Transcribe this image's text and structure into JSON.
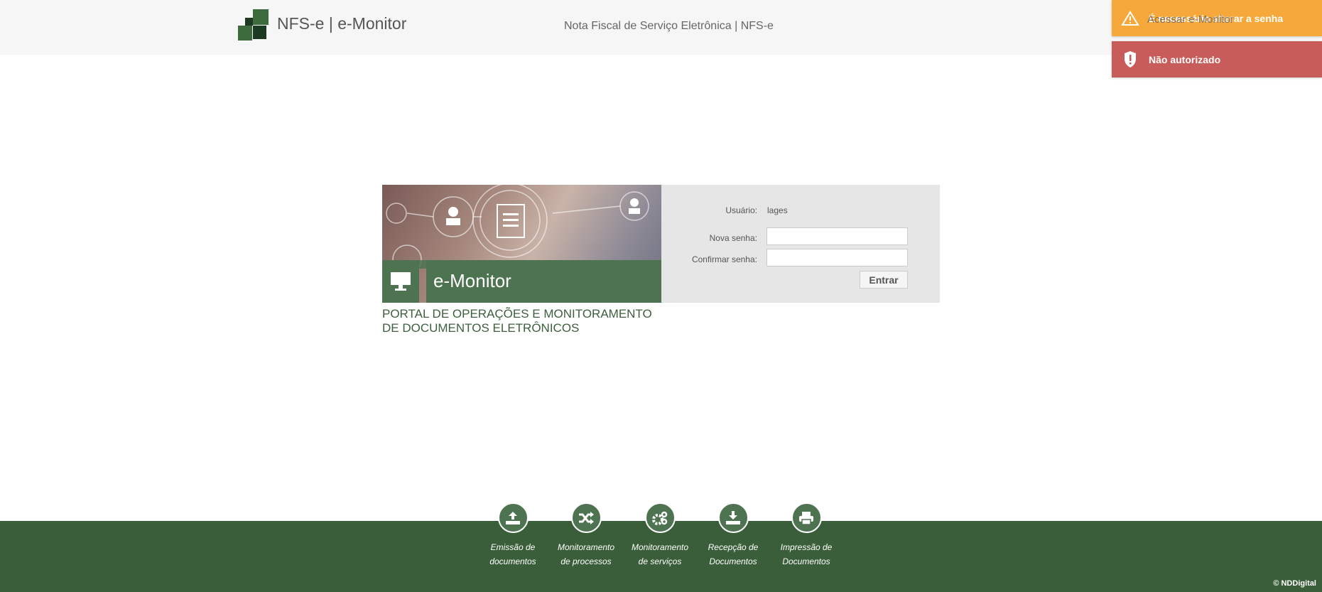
{
  "header": {
    "title": "NFS-e | e-Monitor",
    "subtitle": "Nota Fiscal de Serviço Eletrônica | NFS-e",
    "link": "Acessar e-Monitor"
  },
  "toasts": [
    {
      "text": "É necessário alterar a senha",
      "icon": "warning-icon",
      "color": "#f6a83a"
    },
    {
      "text": "Não autorizado",
      "icon": "shield-alert-icon",
      "color": "#c75c5a"
    }
  ],
  "card": {
    "title": "e-Monitor",
    "portal_line1": "PORTAL DE OPERAÇÕES E MONITORAMENTO",
    "portal_line2": "DE DOCUMENTOS ELETRÔNICOS"
  },
  "form": {
    "user_label": "Usuário:",
    "user_value": "lages",
    "new_password_label": "Nova senha:",
    "confirm_password_label": "Confirmar senha:",
    "new_password_value": "",
    "confirm_password_value": "",
    "submit": "Entrar"
  },
  "footer": {
    "items": [
      {
        "l1": "Emissão de",
        "l2": "documentos"
      },
      {
        "l1": "Monitoramento",
        "l2": "de processos"
      },
      {
        "l1": "Monitoramento",
        "l2": "de serviços"
      },
      {
        "l1": "Recepção de",
        "l2": "Documentos"
      },
      {
        "l1": "Impressão de",
        "l2": "Documentos"
      }
    ],
    "copyright": "© NDDigital"
  }
}
